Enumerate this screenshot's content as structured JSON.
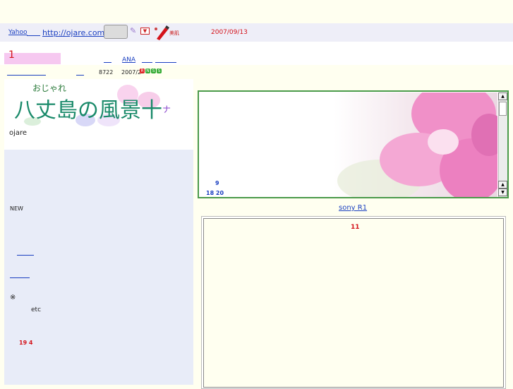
{
  "header": {
    "yahoo_link": "Yahoo",
    "url_link": "http://ojare.com/",
    "date": "2007/09/13",
    "feel_label": "美肌"
  },
  "nav": {
    "number": "1",
    "ana_link": "ANA"
  },
  "stats": {
    "count": "8722",
    "date": "2007/2",
    "badges": [
      "R",
      "N",
      "S",
      "S"
    ]
  },
  "sidebar": {
    "banner_small": "おじゃれ",
    "banner_title": "八丈島の風景十",
    "banner_tail": "ナ",
    "site_name": "ojare",
    "new_label": "NEW",
    "note_mark": "※",
    "etc_label": "etc",
    "red_numbers": "19 4"
  },
  "main": {
    "photo_number_1": "9",
    "photo_number_2": "18 20",
    "sony_link": "sony R1",
    "box_number": "11"
  },
  "colors": {
    "accent_red": "#d4121a",
    "link_blue": "#1a3fc0",
    "frame_green": "#4a9a4a",
    "sidebar_bg": "#e8ecf8",
    "page_bg": "#fffff0"
  }
}
